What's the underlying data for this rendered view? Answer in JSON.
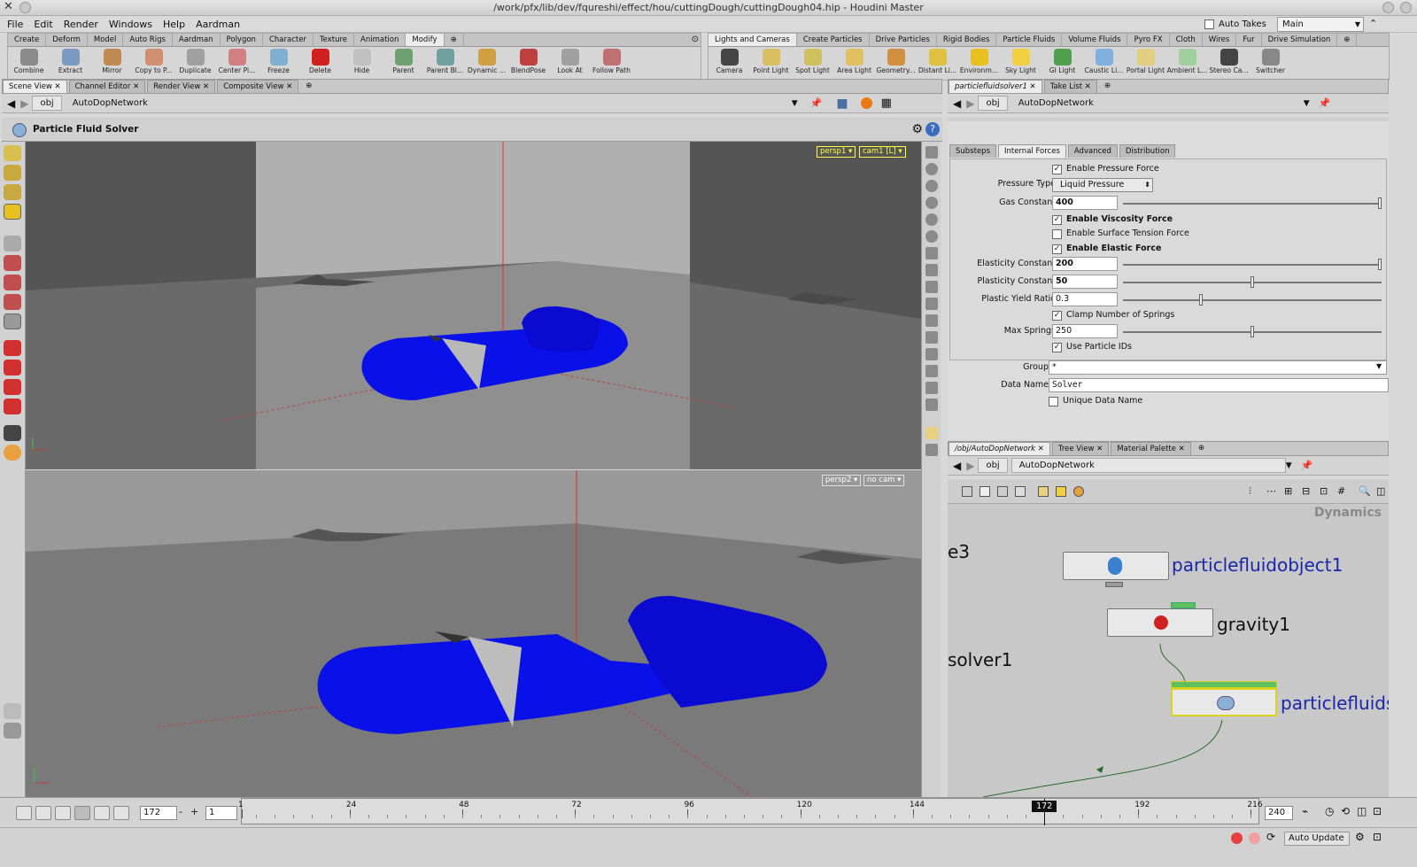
{
  "window": {
    "title": "/work/pfx/lib/dev/fqureshi/effect/hou/cuttingDough/cuttingDough04.hip - Houdini Master"
  },
  "menu": [
    "File",
    "Edit",
    "Render",
    "Windows",
    "Help",
    "Aardman"
  ],
  "desktop": {
    "auto_takes": "Auto Takes",
    "take": "Main"
  },
  "shelf_left": {
    "tabs": [
      "Create",
      "Deform",
      "Model",
      "Auto Rigs",
      "Aardman",
      "Polygon",
      "Character",
      "Texture",
      "Animation",
      "Modify"
    ],
    "tools": [
      "Combine",
      "Extract",
      "Mirror",
      "Copy to P...",
      "Duplicate",
      "Center Pi...",
      "Freeze",
      "Delete",
      "Hide",
      "Parent",
      "Parent Bl...",
      "Dynamic ...",
      "BlendPose",
      "Look At",
      "Follow Path"
    ]
  },
  "shelf_right": {
    "tabs": [
      "Lights and Cameras",
      "Create Particles",
      "Drive Particles",
      "Rigid Bodies",
      "Particle Fluids",
      "Volume Fluids",
      "Pyro FX",
      "Cloth",
      "Wires",
      "Fur",
      "Drive Simulation"
    ],
    "tools": [
      "Camera",
      "Point Light",
      "Spot Light",
      "Area Light",
      "Geometry...",
      "Distant Li...",
      "Environm...",
      "Sky Light",
      "GI Light",
      "Caustic Li...",
      "Portal Light",
      "Ambient L...",
      "Stereo Ca...",
      "Switcher"
    ]
  },
  "left_pane": {
    "tabs": [
      "Scene View",
      "Channel Editor",
      "Render View",
      "Composite View"
    ],
    "path": [
      "obj",
      "AutoDopNetwork"
    ],
    "op_title": "Particle Fluid Solver",
    "viewport_top": {
      "camera": "persp1",
      "cam_menu": "cam1 [L]"
    },
    "viewport_bottom": {
      "camera": "persp2",
      "cam_menu": "no cam"
    }
  },
  "params": {
    "tabs": [
      "particlefluidsolver1",
      "Take List"
    ],
    "path": [
      "obj",
      "AutoDopNetwork"
    ],
    "op_type": "Particle Fluid Solver",
    "op_name": "particlefluidsolver1",
    "subtabs": [
      "Substeps",
      "Internal Forces",
      "Advanced",
      "Distribution"
    ],
    "enable_pressure": "Enable Pressure Force",
    "pressure_type_label": "Pressure Type",
    "pressure_type_value": "Liquid Pressure",
    "gas_constant_label": "Gas Constant",
    "gas_constant": "400",
    "enable_viscosity": "Enable Viscosity Force",
    "enable_surface_tension": "Enable Surface Tension Force",
    "enable_elastic": "Enable Elastic Force",
    "elasticity_label": "Elasticity Constant",
    "elasticity": "200",
    "plasticity_label": "Plasticity Constant",
    "plasticity": "50",
    "yield_label": "Plastic Yield Ratio",
    "yield_ratio": "0.3",
    "clamp_springs": "Clamp Number of Springs",
    "max_springs_label": "Max Springs",
    "max_springs": "250",
    "use_ids": "Use Particle IDs",
    "group_label": "Group",
    "group": "*",
    "data_name_label": "Data Name",
    "data_name": "Solver",
    "unique_data_name": "Unique Data Name",
    "checks": {
      "pressure": true,
      "viscosity": true,
      "surface": false,
      "elastic": true,
      "clamp": true,
      "ids": true,
      "unique": false
    },
    "slider_levels": {
      "gas": 1.0,
      "elastic": 1.0,
      "plastic": 0.5,
      "yield": 0.3,
      "springs": 0.5
    }
  },
  "network": {
    "tabs": [
      "/obj/AutoDopNetwork",
      "Tree View",
      "Material Palette"
    ],
    "path": [
      "obj",
      "AutoDopNetwork"
    ],
    "context": "Dynamics",
    "nodes": {
      "n1": "particlefluidobject1",
      "n2": "gravity1",
      "n3": "particlefluids",
      "e3": "e3",
      "solver1": "solver1"
    }
  },
  "timeline": {
    "current_frame": "172",
    "start": "1",
    "end": "240",
    "ticks": [
      "1",
      "24",
      "48",
      "72",
      "96",
      "120",
      "144",
      "172",
      "192",
      "216"
    ],
    "tick_frames": [
      1,
      24,
      48,
      72,
      96,
      120,
      144,
      192,
      216
    ]
  },
  "status": {
    "auto_update": "Auto Update"
  },
  "colors": {
    "fluid": "#0a10e8",
    "node_label": "#1a25a8",
    "selected_node": "#e0d020",
    "viewport_label": "#ffff40"
  }
}
